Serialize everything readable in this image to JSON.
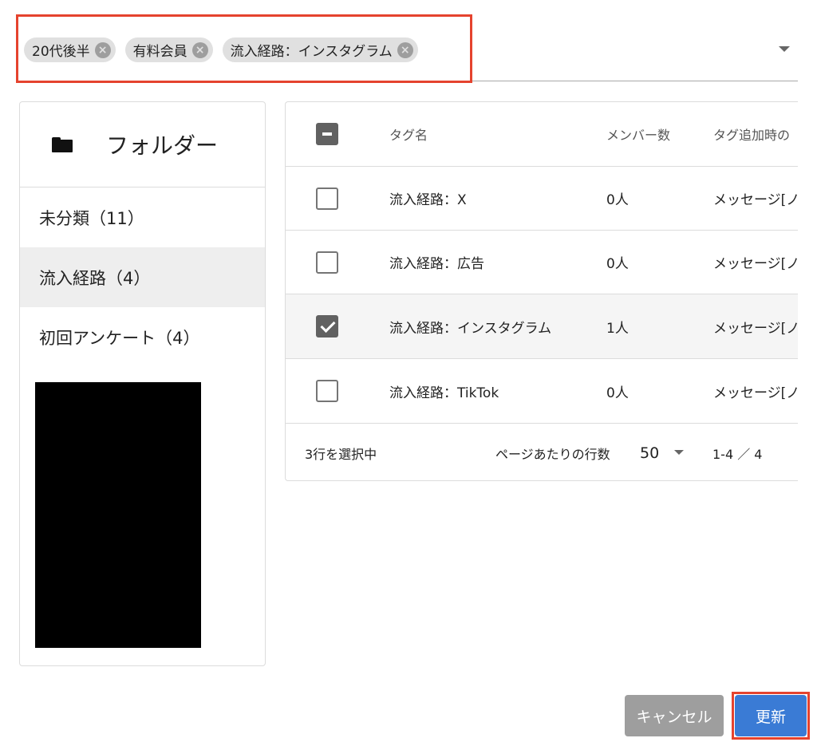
{
  "tag_select": {
    "chips": [
      {
        "label": "20代後半"
      },
      {
        "label": "有料会員"
      },
      {
        "label": "流入経路：インスタグラム"
      }
    ]
  },
  "folders": {
    "title": "フォルダー",
    "items": [
      {
        "label": "未分類（11）",
        "active": false
      },
      {
        "label": "流入経路（4）",
        "active": true
      },
      {
        "label": "初回アンケート（4）",
        "active": false
      }
    ]
  },
  "table": {
    "headers": {
      "name": "タグ名",
      "count": "メンバー数",
      "action": "タグ追加時の"
    },
    "rows": [
      {
        "name": "流入経路：X",
        "count": "0人",
        "action": "メッセージ[ノ",
        "checked": false
      },
      {
        "name": "流入経路：広告",
        "count": "0人",
        "action": "メッセージ[ノ",
        "checked": false
      },
      {
        "name": "流入経路：インスタグラム",
        "count": "1人",
        "action": "メッセージ[ノ",
        "checked": true
      },
      {
        "name": "流入経路：TikTok",
        "count": "0人",
        "action": "メッセージ[ノ",
        "checked": false
      }
    ],
    "footer": {
      "selected": "3行を選択中",
      "rows_per_page_label": "ページあたりの行数",
      "rows_per_page_value": "50",
      "range": "1-4 ／ 4"
    }
  },
  "buttons": {
    "cancel": "キャンセル",
    "update": "更新"
  },
  "colors": {
    "accent": "#3a7bd5",
    "highlight": "#e5432e",
    "cancel": "#9e9e9e"
  }
}
